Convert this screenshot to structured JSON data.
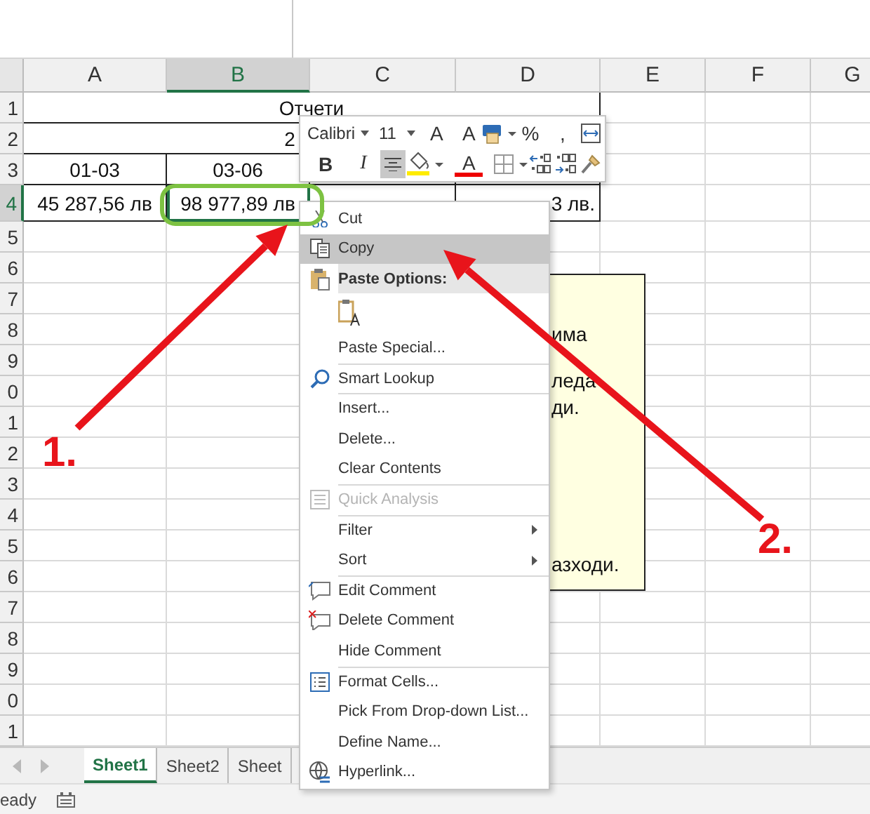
{
  "columns": [
    {
      "label": "A",
      "selected": false
    },
    {
      "label": "B",
      "selected": true
    },
    {
      "label": "C",
      "selected": false
    },
    {
      "label": "D",
      "selected": false
    },
    {
      "label": "E",
      "selected": false
    },
    {
      "label": "F",
      "selected": false
    },
    {
      "label": "G",
      "selected": false
    }
  ],
  "rows": [
    {
      "label": "1",
      "selected": false
    },
    {
      "label": "2",
      "selected": false
    },
    {
      "label": "3",
      "selected": false
    },
    {
      "label": "4",
      "selected": true
    },
    {
      "label": "5",
      "selected": false
    },
    {
      "label": "6",
      "selected": false
    },
    {
      "label": "7",
      "selected": false
    },
    {
      "label": "8",
      "selected": false
    },
    {
      "label": "9",
      "selected": false
    },
    {
      "label": "0",
      "selected": false
    },
    {
      "label": "1",
      "selected": false
    },
    {
      "label": "2",
      "selected": false
    },
    {
      "label": "3",
      "selected": false
    },
    {
      "label": "4",
      "selected": false
    },
    {
      "label": "5",
      "selected": false
    },
    {
      "label": "6",
      "selected": false
    },
    {
      "label": "7",
      "selected": false
    },
    {
      "label": "8",
      "selected": false
    },
    {
      "label": "9",
      "selected": false
    },
    {
      "label": "0",
      "selected": false
    },
    {
      "label": "1",
      "selected": false
    }
  ],
  "report": {
    "title": "Отчети",
    "subtitle": "2",
    "periods": [
      "01-03",
      "03-06"
    ],
    "values": [
      {
        "text": "45 287,56 лв",
        "selected": false
      },
      {
        "text": "98 977,89 лв",
        "selected": true
      },
      {
        "text": "3 лв.",
        "selected": false
      }
    ]
  },
  "mini_toolbar": {
    "font": "Calibri",
    "font_size": "11",
    "top": [
      {
        "kind": "grow",
        "text": "A",
        "selected": false
      },
      {
        "kind": "shrink",
        "text": "A",
        "selected": false
      },
      {
        "kind": "accounting",
        "selected": false
      },
      {
        "kind": "glyph",
        "text": "%",
        "selected": false
      },
      {
        "kind": "glyph",
        "text": ",",
        "selected": false
      },
      {
        "kind": "merge",
        "selected": false
      }
    ],
    "bottom": [
      {
        "kind": "bold",
        "text": "B",
        "selected": false
      },
      {
        "kind": "italic",
        "text": "I",
        "selected": false
      },
      {
        "kind": "align",
        "selected": true
      },
      {
        "kind": "fill",
        "selected": false
      },
      {
        "kind": "fontcolor",
        "text": "A",
        "selected": false
      },
      {
        "kind": "borders",
        "selected": false
      },
      {
        "kind": "incdec",
        "selected": false
      },
      {
        "kind": "decdec",
        "selected": false
      },
      {
        "kind": "painter",
        "selected": false
      }
    ]
  },
  "comment": {
    "lines": [
      "има",
      "леда",
      "ди.",
      "азходи."
    ]
  },
  "context_menu": [
    {
      "kind": "cut",
      "label": "Cut",
      "selected": false,
      "disabled": false,
      "submenu": false,
      "separator_before": false
    },
    {
      "kind": "copy",
      "label": "Copy",
      "selected": true,
      "disabled": false,
      "submenu": false,
      "separator_before": false
    },
    {
      "kind": "header",
      "label": "Paste Options:",
      "selected": false,
      "disabled": false,
      "submenu": false,
      "separator_before": false
    },
    {
      "kind": "paste",
      "selected": false,
      "disabled": false,
      "submenu": false,
      "separator_before": false
    },
    {
      "kind": "plain",
      "label": "Paste Special...",
      "selected": false,
      "disabled": false,
      "submenu": false,
      "separator_before": false
    },
    {
      "kind": "lookup",
      "label": "Smart Lookup",
      "selected": false,
      "disabled": false,
      "submenu": false,
      "separator_before": true
    },
    {
      "kind": "plain",
      "label": "Insert...",
      "selected": false,
      "disabled": false,
      "submenu": false,
      "separator_before": true
    },
    {
      "kind": "plain",
      "label": "Delete...",
      "selected": false,
      "disabled": false,
      "submenu": false,
      "separator_before": false
    },
    {
      "kind": "plain",
      "label": "Clear Contents",
      "selected": false,
      "disabled": false,
      "submenu": false,
      "separator_before": false
    },
    {
      "kind": "analysis",
      "label": "Quick Analysis",
      "selected": false,
      "disabled": true,
      "submenu": false,
      "separator_before": true
    },
    {
      "kind": "plain",
      "label": "Filter",
      "selected": false,
      "disabled": false,
      "submenu": true,
      "separator_before": true
    },
    {
      "kind": "plain",
      "label": "Sort",
      "selected": false,
      "disabled": false,
      "submenu": true,
      "separator_before": false
    },
    {
      "kind": "comment-edit",
      "label": "Edit Comment",
      "selected": false,
      "disabled": false,
      "submenu": false,
      "separator_before": true
    },
    {
      "kind": "comment-delete",
      "label": "Delete Comment",
      "selected": false,
      "disabled": false,
      "submenu": false,
      "separator_before": false
    },
    {
      "kind": "plain",
      "label": "Hide Comment",
      "selected": false,
      "disabled": false,
      "submenu": false,
      "separator_before": false
    },
    {
      "kind": "format",
      "label": "Format Cells...",
      "selected": false,
      "disabled": false,
      "submenu": false,
      "separator_before": true
    },
    {
      "kind": "plain",
      "label": "Pick From Drop-down List...",
      "selected": false,
      "disabled": false,
      "submenu": false,
      "separator_before": false
    },
    {
      "kind": "plain",
      "label": "Define Name...",
      "selected": false,
      "disabled": false,
      "submenu": false,
      "separator_before": false
    },
    {
      "kind": "link",
      "label": "Hyperlink...",
      "selected": false,
      "disabled": false,
      "submenu": false,
      "separator_before": false
    }
  ],
  "annotations": [
    {
      "label": "1."
    },
    {
      "label": "2."
    }
  ],
  "sheet_tabs": [
    {
      "label": "Sheet1",
      "selected": true
    },
    {
      "label": "Sheet2",
      "selected": false
    },
    {
      "label": "Sheet",
      "selected": false
    }
  ],
  "status_bar": {
    "text": "eady"
  }
}
